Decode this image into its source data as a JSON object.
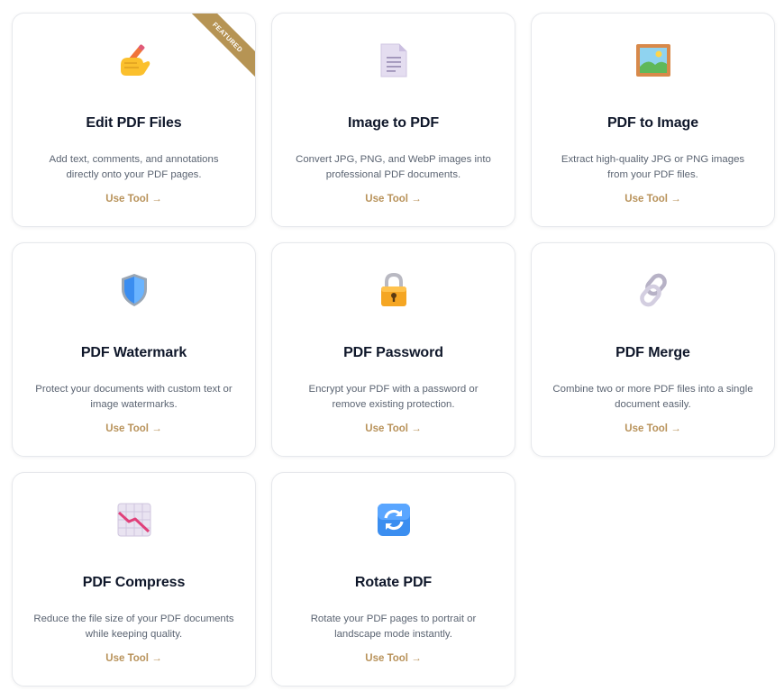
{
  "accent_color": "#b8925a",
  "featured_label": "FEATURED",
  "tools": [
    {
      "title": "Edit PDF Files",
      "description": "Add text, comments, and annotations directly onto your PDF pages.",
      "cta": "Use Tool →",
      "icon": "writing-hand-icon"
    },
    {
      "title": "Image to PDF",
      "description": "Convert JPG, PNG, and WebP images into professional PDF documents.",
      "cta": "Use Tool →",
      "icon": "document-icon"
    },
    {
      "title": "PDF to Image",
      "description": "Extract high-quality JPG or PNG images from your PDF files.",
      "cta": "Use Tool →",
      "icon": "framed-picture-icon"
    },
    {
      "title": "PDF Watermark",
      "description": "Protect your documents with custom text or image watermarks.",
      "cta": "Use Tool →",
      "icon": "shield-icon"
    },
    {
      "title": "PDF Password",
      "description": "Encrypt your PDF with a password or remove existing protection.",
      "cta": "Use Tool →",
      "icon": "lock-icon"
    },
    {
      "title": "PDF Merge",
      "description": "Combine two or more PDF files into a single document easily.",
      "cta": "Use Tool →",
      "icon": "chain-link-icon"
    },
    {
      "title": "PDF Compress",
      "description": "Reduce the file size of your PDF documents while keeping quality.",
      "cta": "Use Tool →",
      "icon": "chart-decreasing-icon"
    },
    {
      "title": "Rotate PDF",
      "description": "Rotate your PDF pages to portrait or landscape mode instantly.",
      "cta": "Use Tool →",
      "icon": "rotate-arrows-icon"
    }
  ]
}
